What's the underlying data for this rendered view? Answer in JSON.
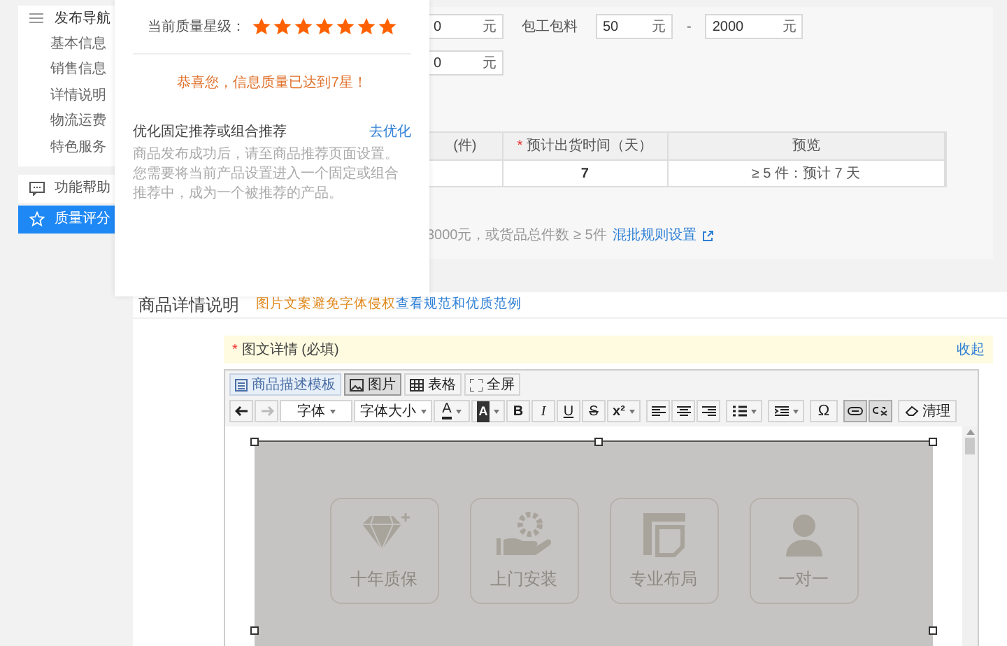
{
  "sidebar": {
    "nav_title": "发布导航",
    "items": [
      {
        "label": "基本信息"
      },
      {
        "label": "销售信息"
      },
      {
        "label": "详情说明"
      },
      {
        "label": "物流运费"
      },
      {
        "label": "特色服务"
      }
    ],
    "extra": [
      {
        "kind": "help",
        "label": "功能帮助",
        "selected": false
      },
      {
        "kind": "quality",
        "label": "质量评分",
        "selected": true
      }
    ]
  },
  "quality_popup": {
    "label": "当前质量星级：",
    "stars": 7,
    "message": "恭喜您，信息质量已达到7星！",
    "tip_title": "优化固定推荐或组合推荐",
    "tip_link": "去优化",
    "tip_text": "商品发布成功后，请至商品推荐页面设置。您需要将当前产品设置进入一个固定或组合推荐中，成为一个被推荐的产品。"
  },
  "price_form": {
    "row_1": [
      {
        "kind": "input",
        "value": "0",
        "unit": "元"
      },
      {
        "kind": "label",
        "text": "包工包料"
      },
      {
        "kind": "input",
        "value": "50",
        "unit": "元"
      },
      {
        "kind": "dash",
        "text": "-"
      },
      {
        "kind": "input",
        "value": "2000",
        "unit": "元"
      }
    ],
    "row_2": [
      {
        "kind": "input",
        "value": "0",
        "unit": "元"
      }
    ]
  },
  "delivery_table": {
    "columns": [
      {
        "label": "(件)"
      },
      {
        "label": "预计出货时间（天）",
        "mark": "*"
      },
      {
        "label": "预览"
      }
    ],
    "rows": [
      [
        "",
        "7",
        "≥ 5 件：预计 7 天"
      ]
    ]
  },
  "mixed_batch": {
    "text": "3000元，或货品总件数 ≥ 5件",
    "link": "混批规则设置"
  },
  "details": {
    "title": "商品详情说明",
    "warning": "图片文案避免字体侵权",
    "link": "查看规范和优质范例",
    "field": {
      "mark": "*",
      "label": "图文详情 (必填)",
      "collapse": "收起"
    },
    "tabs": [
      {
        "kind": "template",
        "label": "商品描述模板",
        "selected": false
      },
      {
        "kind": "image",
        "label": "图片",
        "selected": true
      },
      {
        "kind": "table",
        "label": "表格",
        "selected": false
      },
      {
        "kind": "fullscreen",
        "label": "全屏",
        "selected": false
      }
    ],
    "toolbar": [
      {
        "kind": "undo",
        "pressed": false,
        "disabled": false
      },
      {
        "kind": "redo",
        "pressed": false,
        "disabled": true
      },
      {
        "kind": "select",
        "label": "字体",
        "pressed": false,
        "disabled": false
      },
      {
        "kind": "select",
        "label": "字体大小",
        "pressed": false,
        "disabled": false
      },
      {
        "kind": "color",
        "label": "A",
        "pressed": false,
        "disabled": false
      },
      {
        "kind": "bgcolor",
        "label": "A",
        "pressed": false,
        "disabled": false
      },
      {
        "kind": "bold",
        "label": "B",
        "pressed": false,
        "disabled": false
      },
      {
        "kind": "italic",
        "label": "I",
        "pressed": false,
        "disabled": false
      },
      {
        "kind": "underline",
        "label": "U",
        "pressed": false,
        "disabled": false
      },
      {
        "kind": "strike",
        "label": "S",
        "pressed": false,
        "disabled": false
      },
      {
        "kind": "super",
        "label": "x²",
        "pressed": false,
        "disabled": false
      },
      {
        "kind": "align_left",
        "pressed": false,
        "disabled": false
      },
      {
        "kind": "align_center",
        "pressed": false,
        "disabled": false
      },
      {
        "kind": "align_right",
        "pressed": false,
        "disabled": false
      },
      {
        "kind": "list",
        "pressed": false,
        "disabled": false
      },
      {
        "kind": "indent",
        "pressed": false,
        "disabled": false
      },
      {
        "kind": "symbol",
        "label": "Ω",
        "pressed": false,
        "disabled": false
      },
      {
        "kind": "link",
        "pressed": true,
        "disabled": false
      },
      {
        "kind": "unlink",
        "pressed": true,
        "disabled": false
      },
      {
        "kind": "clean",
        "label": "清理",
        "pressed": false,
        "disabled": false
      }
    ],
    "tiles": [
      {
        "kind": "diamond",
        "label": "十年质保"
      },
      {
        "kind": "hand_gear",
        "label": "上门安装"
      },
      {
        "kind": "layout",
        "label": "专业布局"
      },
      {
        "kind": "person",
        "label": "一对一"
      }
    ]
  }
}
